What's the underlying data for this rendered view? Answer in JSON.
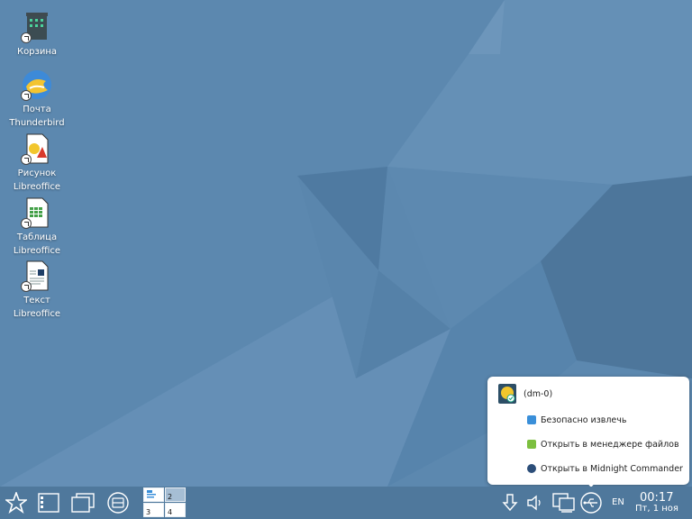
{
  "desktop": {
    "icons": [
      {
        "name": "trash",
        "label_line1": "Корзина",
        "label_line2": ""
      },
      {
        "name": "thunderbird",
        "label_line1": "Почта",
        "label_line2": "Thunderbird"
      },
      {
        "name": "draw",
        "label_line1": "Рисунок",
        "label_line2": "Libreoffice"
      },
      {
        "name": "calc",
        "label_line1": "Таблица",
        "label_line2": "Libreoffice"
      },
      {
        "name": "writer",
        "label_line1": "Текст",
        "label_line2": "Libreoffice"
      }
    ]
  },
  "popup": {
    "device_name": "(dm-0)",
    "items": [
      {
        "label": "Безопасно извлечь",
        "icon": "eject-icon",
        "color": "#3a8fd9"
      },
      {
        "label": "Открыть в менеджере файлов",
        "icon": "file-manager-icon",
        "color": "#7cbf3f"
      },
      {
        "label": "Открыть в Midnight Commander",
        "icon": "midnight-commander-icon",
        "color": "#2c4e79"
      }
    ]
  },
  "taskbar": {
    "pager": {
      "desktops": [
        "1",
        "2",
        "3",
        "4"
      ],
      "active": "2"
    },
    "tray": {
      "language": "EN",
      "clock_time": "00:17",
      "clock_date": "Пт, 1 ноя"
    }
  },
  "colors": {
    "wallpaper": "#5a86ad",
    "taskbar": "#4f789c",
    "popup_bg": "#ffffff"
  }
}
